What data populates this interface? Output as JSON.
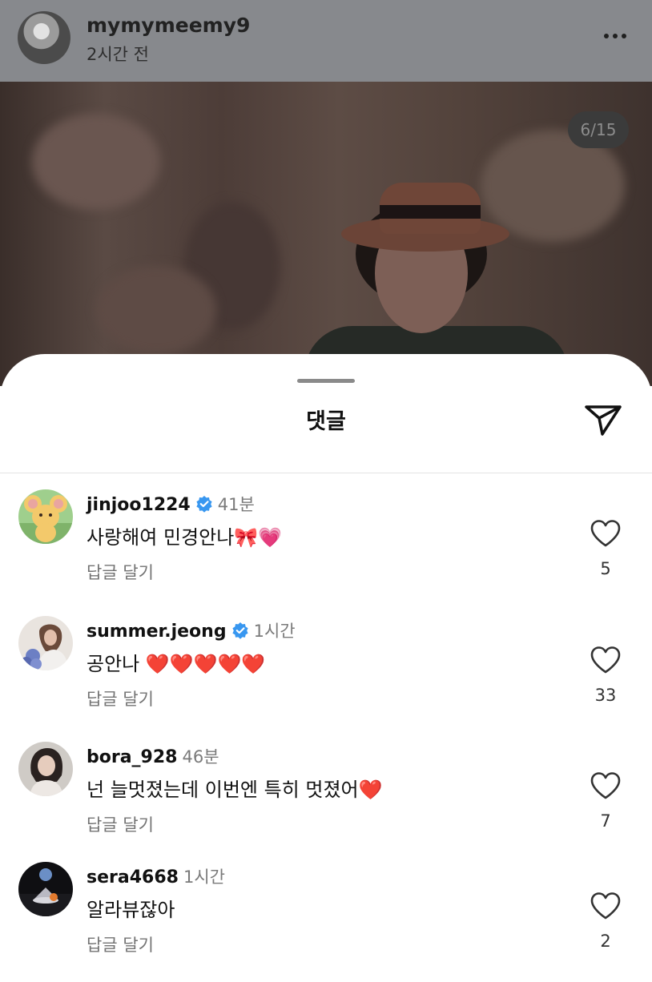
{
  "post": {
    "username": "mymymeemy9",
    "time": "2시간 전",
    "page_counter": "6/15"
  },
  "comments_sheet": {
    "title": "댓글",
    "reply_label": "답글 달기",
    "comments": [
      {
        "username": "jinjoo1224",
        "verified": true,
        "time": "41분",
        "text": "사랑해여 민경안나🎀💗",
        "likes": "5",
        "avatar_icon": "teddy-mouse-avatar"
      },
      {
        "username": "summer.jeong",
        "verified": true,
        "time": "1시간",
        "text": "공안나 ❤️❤️❤️❤️❤️",
        "likes": "33",
        "avatar_icon": "profile-photo-avatar"
      },
      {
        "username": "bora_928",
        "verified": false,
        "time": "46분",
        "text": "넌 늘멋졌는데 이번엔 특히 멋졌어❤️",
        "likes": "7",
        "avatar_icon": "profile-photo-avatar"
      },
      {
        "username": "sera4668",
        "verified": false,
        "time": "1시간",
        "text": "알라뷰잖아",
        "likes": "2",
        "avatar_icon": "moon-scene-avatar"
      }
    ]
  },
  "colors": {
    "verified_badge": "#3897f0",
    "heart_emoji": "#e0191f",
    "dim_overlay": "#87898d"
  }
}
